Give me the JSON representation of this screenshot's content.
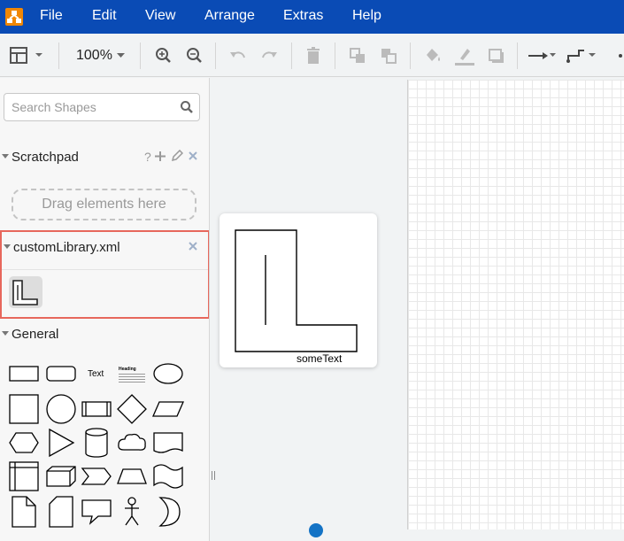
{
  "menubar": {
    "items": [
      "File",
      "Edit",
      "View",
      "Arrange",
      "Extras",
      "Help"
    ],
    "background": "#0a4bb5",
    "logo_color": "#f08705"
  },
  "toolbar": {
    "zoom": "100%",
    "icons": [
      "format-panel-icon",
      "zoom-in-icon",
      "zoom-out-icon",
      "undo-icon",
      "redo-icon",
      "delete-icon",
      "to-front-icon",
      "to-back-icon",
      "fill-color-icon",
      "line-color-icon",
      "shadow-icon",
      "connection-arrow-icon",
      "waypoints-icon"
    ]
  },
  "sidebar": {
    "search": {
      "placeholder": "Search Shapes",
      "value": ""
    },
    "scratchpad": {
      "title": "Scratchpad",
      "help": "?",
      "drop_hint": "Drag elements here"
    },
    "custom_library": {
      "title": "customLibrary.xml",
      "border_color": "#e7675c"
    },
    "general": {
      "title": "General",
      "text_shape": "Text",
      "heading_shape": "Heading"
    }
  },
  "preview": {
    "label": "someText"
  },
  "accent": "#1473c5"
}
